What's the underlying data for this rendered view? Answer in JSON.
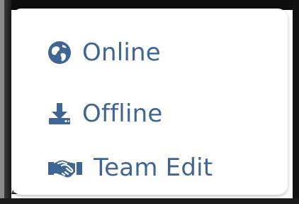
{
  "menu": {
    "items": [
      {
        "label": "Online",
        "icon": "globe-icon"
      },
      {
        "label": "Offline",
        "icon": "download-icon"
      },
      {
        "label": "Team Edit",
        "icon": "handshake-icon"
      }
    ]
  },
  "colors": {
    "accent": "#3e6594",
    "background": "#ffffff",
    "frame": "#0d0d0d"
  }
}
